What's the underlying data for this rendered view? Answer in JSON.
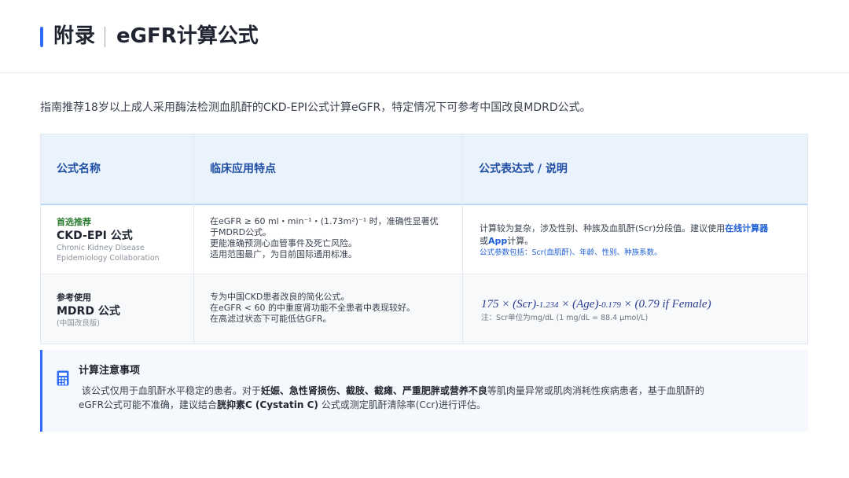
{
  "header": {
    "title_main": "附录",
    "title_sub": "eGFR计算公式"
  },
  "intro": "指南推荐18岁以上成人采用酶法检测血肌酐的CKD-EPI公式计算eGFR，特定情况下可参考中国改良MDRD公式。",
  "table": {
    "headers": [
      "公式名称",
      "临床应用特点",
      "公式表达式 / 说明"
    ],
    "rows": [
      {
        "tag": "首选推荐",
        "name": "CKD-EPI 公式",
        "sub_1": "Chronic Kidney Disease",
        "sub_2": "Epidemiology Collaboration",
        "features": [
          "在eGFR ≥ 60 ml・min⁻¹・(1.73m²)⁻¹ 时，准确性显著优",
          "于MDRD公式。",
          "更能准确预测心血管事件及死亡风险。",
          "适用范围最广，为目前国际通用标准。"
        ],
        "expl_a": "计算较为复杂，涉及性别、种族及血肌酐(Scr)分段值。建议使用",
        "expl_link1": "在线计算器",
        "expl_b": "或",
        "expl_link2": "App",
        "expl_c": "计算。",
        "params": "公式参数包括：Scr(血肌酐)、年龄、性别、种族系数。"
      },
      {
        "tag": "参考使用",
        "name": "MDRD 公式",
        "sub_1": "(中国改良版)",
        "features": [
          "专为中国CKD患者改良的简化公式。",
          "在eGFR < 60 的中重度肾功能不全患者中表现较好。",
          "在高滤过状态下可能低估GFR。"
        ],
        "formula": {
          "p1": "175 × (Scr)",
          "e1": "-1.234",
          "p2": " × (Age)",
          "e2": "-0.179",
          "p3": " × (0.79 if Female)"
        },
        "note": "注：Scr单位为mg/dL (1 mg/dL = 88.4 μmol/L)"
      }
    ]
  },
  "caution": {
    "icon": "calculator-icon",
    "title": "计算注意事项",
    "t1": "该公式仅用于血肌酐水平稳定的患者。对于",
    "b1": "妊娠、急性肾损伤、截肢、截瘫、严重肥胖或营养不良",
    "t2": "等肌肉量异常或肌肉消耗性疾病患者，基于血肌酐的",
    "t3": "eGFR公式可能不准确，建议结合",
    "b2": "胱抑素C (Cystatin C)",
    "t4": " 公式或测定肌酐清除率(Ccr)进行评估。"
  },
  "colors": {
    "accent": "#2f6df6",
    "header_text": "#1f4fa3",
    "recommended_tag": "#2e7d32",
    "link": "#1f5fd6"
  }
}
